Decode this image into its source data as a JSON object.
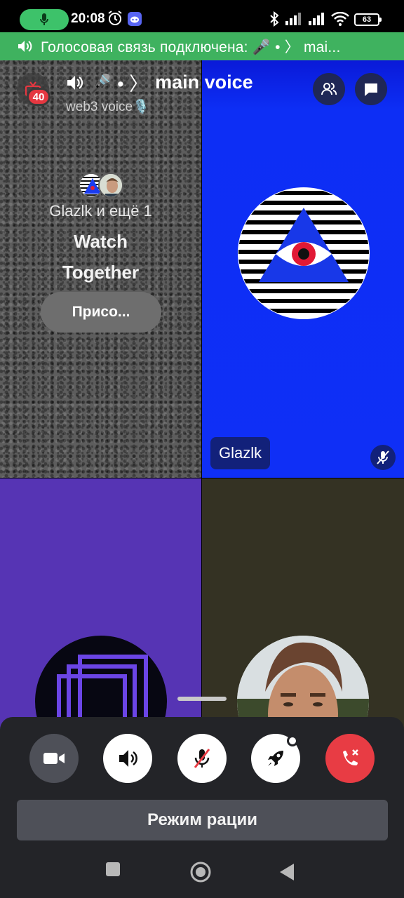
{
  "status_bar": {
    "time": "20:08",
    "battery": "63",
    "icons": [
      "mic-icon",
      "alarm-icon",
      "discord-icon",
      "bluetooth-icon",
      "signal-icon",
      "signal-icon",
      "wifi-icon",
      "battery-icon"
    ]
  },
  "banner": {
    "text": "Голосовая связь подключена: 🎤 • 〉 mai..."
  },
  "header": {
    "channel_prefix": "🎤 • 〉",
    "channel_name": "main voice",
    "server_name": "web3 voice🎙️",
    "notification_count": "40"
  },
  "activity": {
    "participants": "Glazlk и ещё 1",
    "title": "Watch Together",
    "join_label": "Присо..."
  },
  "participants": [
    {
      "name": "Glazlk",
      "muted": true
    }
  ],
  "controls": {
    "push_to_talk_label": "Режим рации"
  },
  "colors": {
    "banner": "#3fb25f",
    "tile_blue": "#0f2ff6",
    "tile_purple": "#5634b4",
    "tile_olive": "#343223",
    "disconnect_red": "#e83c44",
    "sheet": "#232428"
  }
}
